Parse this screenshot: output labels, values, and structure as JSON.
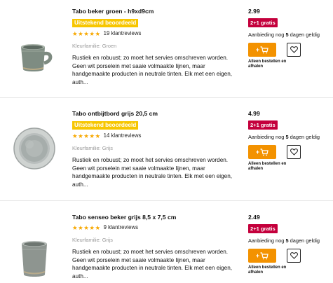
{
  "products": [
    {
      "title": "Tabo beker groen - h9xd9cm",
      "badge": "Uitstekend beoordeeld",
      "stars": "★★★★★",
      "reviews": "19 klantreviews",
      "family": "Kleurfamilie: Groen",
      "description": "Rustiek en robuust; zo moet het servies omschreven worden. Geen wit porselein met saaie volmaakte lijnen, maar handgemaakte producten in neutrale tinten. Elk met een eigen, auth...",
      "price": "2.99",
      "promo": "2+1 gratis",
      "stock_prefix": "Aanbieding nog ",
      "stock_days": "5",
      "stock_suffix": " dagen geldig",
      "cart_label": "+",
      "cart_icon": "cart-icon",
      "wish_icon": "heart-icon",
      "pickup": "Alleen bestellen en afhalen",
      "image": "mug-green"
    },
    {
      "title": "Tabo ontbijtbord grijs 20,5 cm",
      "badge": "Uitstekend beoordeeld",
      "stars": "★★★★★",
      "reviews": "14 klantreviews",
      "family": "Kleurfamilie: Grijs",
      "description": "Rustiek en robuust; zo moet het servies omschreven worden. Geen wit porselein met saaie volmaakte lijnen, maar handgemaakte producten in neutrale tinten. Elk met een eigen, auth...",
      "price": "4.99",
      "promo": "2+1 gratis",
      "stock_prefix": "Aanbieding nog ",
      "stock_days": "5",
      "stock_suffix": " dagen geldig",
      "cart_label": "+",
      "cart_icon": "cart-icon",
      "wish_icon": "heart-icon",
      "pickup": "Alleen bestellen en afhalen",
      "image": "plate-grey"
    },
    {
      "title": "Tabo senseo beker grijs 8,5 x 7,5 cm",
      "badge": "",
      "stars": "★★★★★",
      "reviews": "9 klantreviews",
      "family": "Kleurfamilie: Grijs",
      "description": "Rustiek en robuust; zo moet het servies omschreven worden. Geen wit porselein met saaie volmaakte lijnen, maar handgemaakte producten in neutrale tinten. Elk met een eigen, auth...",
      "price": "2.49",
      "promo": "2+1 gratis",
      "stock_prefix": "Aanbieding nog ",
      "stock_days": "5",
      "stock_suffix": " dagen geldig",
      "cart_label": "+",
      "cart_icon": "cart-icon",
      "wish_icon": "heart-icon",
      "pickup": "Alleen bestellen en afhalen",
      "image": "cup-grey"
    }
  ],
  "colors": {
    "badge": "#f7c600",
    "stars": "#f7a800",
    "promo": "#c4003c",
    "cart": "#f39200",
    "family_text": "#999999"
  }
}
